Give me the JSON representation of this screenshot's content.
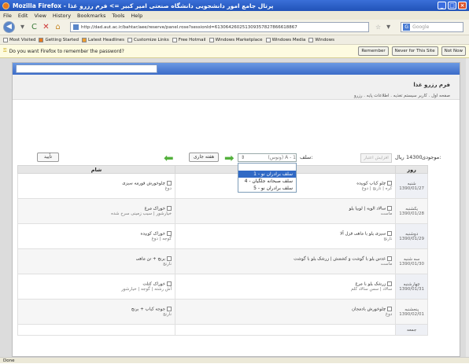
{
  "window": {
    "title": "Mozilla Firefox - پرتال جامع امور دانشجویی دانشگاه صنعتی امیر کبیر => فرم رزرو غذا"
  },
  "menu": [
    "File",
    "Edit",
    "View",
    "History",
    "Bookmarks",
    "Tools",
    "Help"
  ],
  "nav": {
    "url": "http://dad.aut.ac.ir/bahtar/aee/reserve/panel.rose?sessionId=613064260251309357827866618867",
    "search_placeholder": "Google",
    "search_engine_icon": "G"
  },
  "bookmarks": [
    "Most Visited",
    "Getting Started",
    "Latest Headlines",
    "Customize Links",
    "Free Hotmail",
    "Windows Marketplace",
    "Windows Media",
    "Windows"
  ],
  "password_bar": {
    "message": "Do you want Firefox to remember the password?",
    "buttons": [
      "Remember",
      "Never for This Site",
      "Not Now"
    ]
  },
  "page": {
    "title": "فرم رزرو غذا",
    "breadcrumb": "صفحه اول . کاربر سیستم تغذیه . اطلاعات پایه . رزرو"
  },
  "controls": {
    "balance_label": "موجودی:",
    "balance_value": "14300",
    "currency": "ریال",
    "credit_button": "افزایش اعتبار",
    "meal_label": "سلف:",
    "meal_selected": "1 - A (ونوس)",
    "week_button": "هفته جاری",
    "confirm_button": "تأیید",
    "options": [
      "سلف برادران نو - 1",
      "سلف صبحانه جلگیان - 4",
      "سلف برادران نو - 5"
    ]
  },
  "table": {
    "headers": [
      "روز",
      "",
      "شام"
    ],
    "rows": [
      {
        "day": "شنبه",
        "date": "1390/01/27",
        "lunch_name": "چلو کباب کوبیده",
        "lunch_sides": "کره | نارنج | دوغ",
        "dinner_name": "چلوخورش قورمه سبزی",
        "dinner_sides": "دوغ"
      },
      {
        "day": "یکشنبه",
        "date": "1390/01/28",
        "lunch_name": "سالاد الویه | لوبیا پلو",
        "lunch_sides": "ماست",
        "dinner_name": "خوراک مرغ",
        "dinner_sides": "خیارشور | سیب زمینی سرخ شده"
      },
      {
        "day": "دوشنبه",
        "date": "1390/01/29",
        "lunch_name": "سبزی پلو با ماهی قزل آلا",
        "lunch_sides": "نارنج",
        "dinner_name": "خوراک کوبیده",
        "dinner_sides": "گوجه | دوغ"
      },
      {
        "day": "سه شنبه",
        "date": "1390/01/30",
        "lunch_name": "عدس پلو با گوشت و کشمش | زرشک پلو با گوشت",
        "lunch_sides": "ماست",
        "dinner_name": "برنج + تن ماهی",
        "dinner_sides": "نارنج"
      },
      {
        "day": "چهارشنبه",
        "date": "1390/01/31",
        "lunch_name": "زرشک پلو با مرغ",
        "lunch_sides": "سالاد | سس سالاد کلم",
        "dinner_name": "خوراک کتلت",
        "dinner_sides": "آش رشته | گوجه | خیارشور"
      },
      {
        "day": "پنجشنبه",
        "date": "1390/02/01",
        "lunch_name": "چلوخورش بادمجان",
        "lunch_sides": "دوغ",
        "dinner_name": "جوجه کباب + برنج",
        "dinner_sides": "نارنج"
      },
      {
        "day": "جمعه",
        "date": "",
        "lunch_name": "",
        "lunch_sides": "",
        "dinner_name": "",
        "dinner_sides": ""
      }
    ]
  },
  "status": "Done"
}
